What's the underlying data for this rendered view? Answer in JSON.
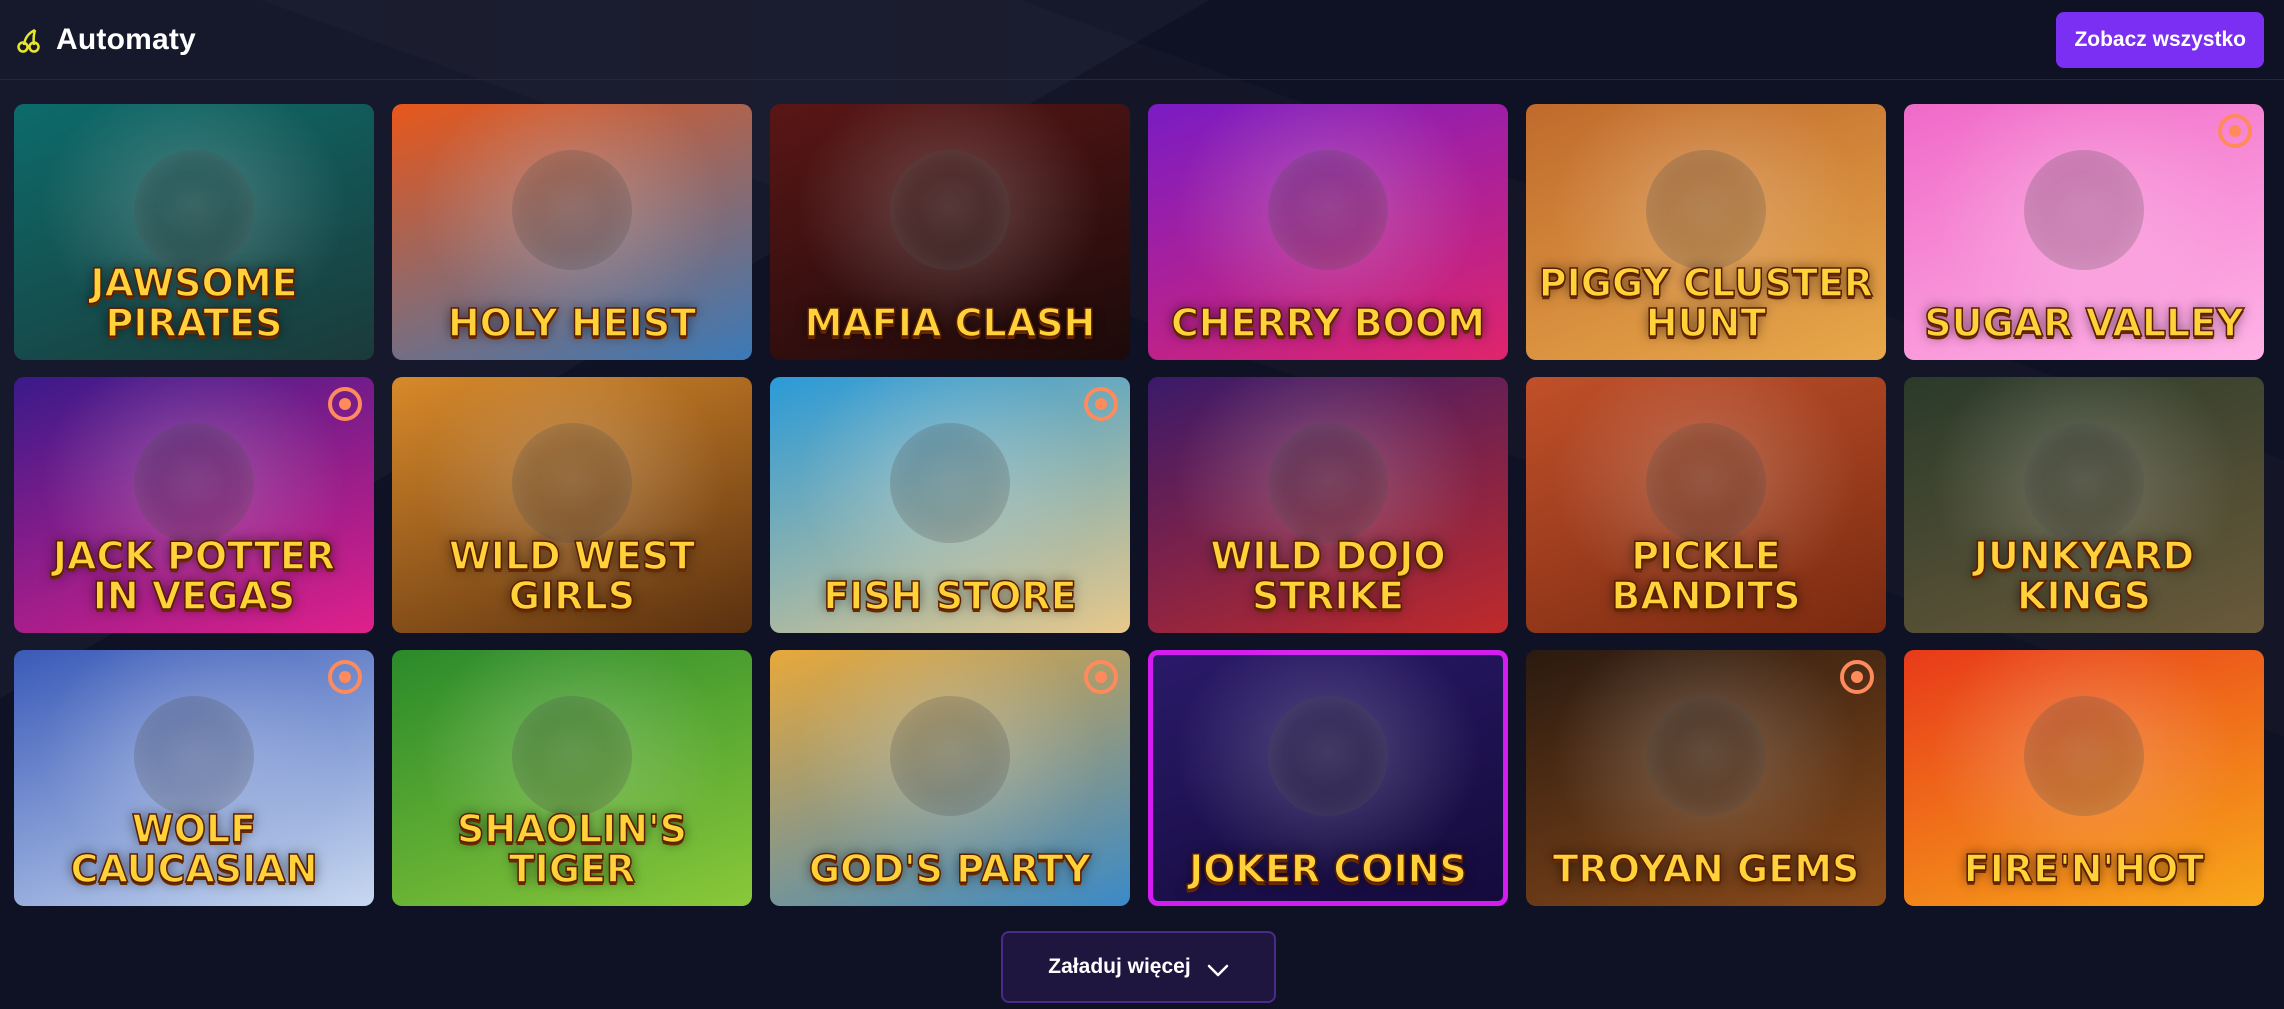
{
  "section": {
    "title": "Automaty",
    "icon": "cherry-icon",
    "see_all_label": "Zobacz wszystko"
  },
  "games": [
    {
      "title": "Jawsome Pirates",
      "colors": [
        "#0d6b6b",
        "#1b3a3a"
      ],
      "badge": false
    },
    {
      "title": "Holy Heist",
      "colors": [
        "#e8571a",
        "#3a7ab8"
      ],
      "badge": false
    },
    {
      "title": "Mafia Clash",
      "colors": [
        "#5a1616",
        "#1c0a0a"
      ],
      "badge": false
    },
    {
      "title": "Cherry Boom",
      "colors": [
        "#7a1cc4",
        "#e0256b"
      ],
      "badge": false
    },
    {
      "title": "Piggy Cluster Hunt",
      "colors": [
        "#c06a2c",
        "#e8a84a"
      ],
      "badge": false
    },
    {
      "title": "Sugar Valley",
      "colors": [
        "#f06ac8",
        "#ffb3e6"
      ],
      "badge": true
    },
    {
      "title": "Jack Potter in Vegas",
      "colors": [
        "#3a1a8a",
        "#e0208a"
      ],
      "badge": true
    },
    {
      "title": "Wild West Girls",
      "colors": [
        "#d88a2a",
        "#5a3010"
      ],
      "badge": false
    },
    {
      "title": "Fish Store",
      "colors": [
        "#2a9ad8",
        "#e8c88a"
      ],
      "badge": true
    },
    {
      "title": "Wild Dojo Strike",
      "colors": [
        "#3a1a6a",
        "#c02a2a"
      ],
      "badge": false
    },
    {
      "title": "Pickle Bandits",
      "colors": [
        "#c0502a",
        "#7a2a10"
      ],
      "badge": false
    },
    {
      "title": "Junkyard Kings",
      "colors": [
        "#2a3a2a",
        "#6a5a3a"
      ],
      "badge": false
    },
    {
      "title": "Wolf Caucasian",
      "colors": [
        "#3a5ab8",
        "#c8d8f0"
      ],
      "badge": true
    },
    {
      "title": "Shaolin's Tiger",
      "colors": [
        "#2a8a2a",
        "#8ac83a"
      ],
      "badge": false
    },
    {
      "title": "God's Party",
      "colors": [
        "#e8a83a",
        "#3a8ac8"
      ],
      "badge": true
    },
    {
      "title": "Joker Coins",
      "colors": [
        "#2a1a6a",
        "#140a3a"
      ],
      "badge": false,
      "selected": true
    },
    {
      "title": "Troyan Gems",
      "colors": [
        "#2a1a10",
        "#8a4a1a"
      ],
      "badge": true
    },
    {
      "title": "Fire'n'Hot",
      "colors": [
        "#e83a1a",
        "#f8a81a"
      ],
      "badge": false
    }
  ],
  "load_more_label": "Załaduj więcej"
}
